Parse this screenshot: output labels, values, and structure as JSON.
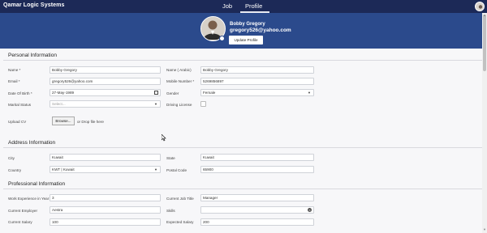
{
  "app": {
    "brand": "Qamar Logic Systems"
  },
  "nav": {
    "tabs": [
      {
        "label": "Job"
      },
      {
        "label": "Profile"
      }
    ]
  },
  "profile": {
    "name": "Bobby Gregory",
    "email": "gregory526@yahoo.com",
    "update_button": "Update Profile"
  },
  "personal": {
    "title": "Personal Information",
    "name": {
      "label": "Name *",
      "value": "Bobby Gregory"
    },
    "name_arabic": {
      "label": "Name ( Arabic)",
      "value": "Bobby Gregory"
    },
    "email": {
      "label": "Email *",
      "value": "gregory526@yahoo.com"
    },
    "mobile": {
      "label": "Mobile Number *",
      "value": "5269856897"
    },
    "dob": {
      "label": "Date Of Birth *",
      "value": "27-May-1989"
    },
    "gender": {
      "label": "Gender",
      "value": "Female"
    },
    "marital": {
      "label": "Marital Status",
      "placeholder": "Select..."
    },
    "driving": {
      "label": "Driving License"
    },
    "cv": {
      "label": "Upload CV",
      "browse": "Browse...",
      "drop": "or Drop file here"
    }
  },
  "address": {
    "title": "Address Information",
    "city": {
      "label": "City",
      "value": "Kuwait"
    },
    "state": {
      "label": "State",
      "value": "Kuwait"
    },
    "country": {
      "label": "Country",
      "value": "KWT | Kuwait"
    },
    "postal": {
      "label": "Postal Code",
      "value": "65900"
    }
  },
  "professional": {
    "title": "Professional Information",
    "experience": {
      "label": "Work Experience in Year",
      "value": "3"
    },
    "job_title": {
      "label": "Current Job Title",
      "value": "Manager"
    },
    "employer": {
      "label": "Current Employer",
      "value": "Aestra"
    },
    "skills": {
      "label": "Skills",
      "value": ""
    },
    "salary": {
      "label": "Current Salary",
      "value": "100"
    },
    "expected_salary": {
      "label": "Expected Salary",
      "value": "200"
    }
  }
}
